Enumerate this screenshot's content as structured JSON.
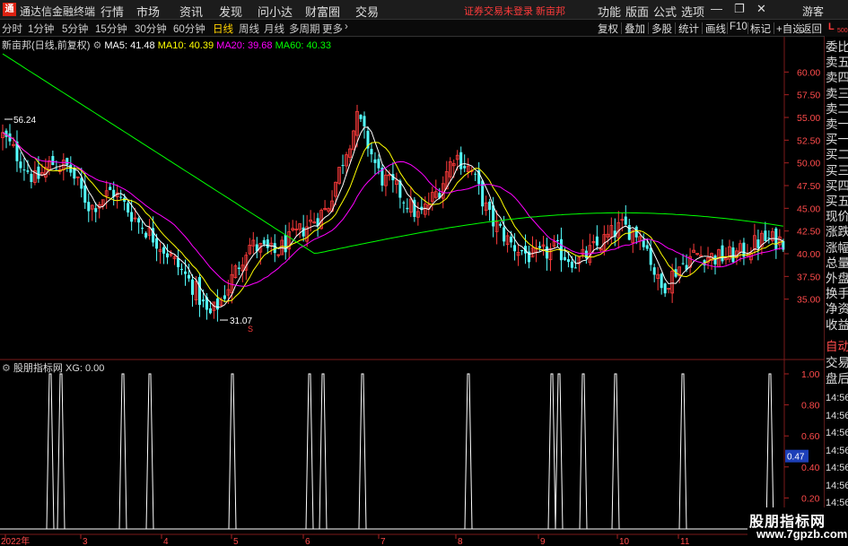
{
  "app": {
    "title": "通达信金融终端",
    "logo_glyph": "通"
  },
  "menu": [
    "行情",
    "市场",
    "资讯",
    "发现",
    "问小达",
    "财富圈",
    "交易"
  ],
  "warning": "证券交易未登录  新亩邦",
  "right_menu": [
    "功能",
    "版面",
    "公式",
    "选项"
  ],
  "guest_label": "游客",
  "periods": [
    "分时",
    "1分钟",
    "5分钟",
    "15分钟",
    "30分钟",
    "60分钟",
    "日线",
    "周线",
    "月线",
    "多周期",
    "更多"
  ],
  "active_period": "日线",
  "right_tools": [
    "复权",
    "叠加",
    "多股",
    "统计",
    "画线",
    "F10",
    "标记",
    "+自选",
    "返回"
  ],
  "l_badge": {
    "letter": "L",
    "num": "500"
  },
  "main_legend": {
    "name": "新亩邦(日线,前复权)",
    "ma5": "MA5: 41.48",
    "ma10": "MA10: 40.39",
    "ma20": "MA20: 39.68",
    "ma60": "MA60: 40.33"
  },
  "sub_legend": {
    "name": "股朋指标网",
    "xg": "XG: 0.00"
  },
  "quote_panel": [
    "委比",
    "卖五",
    "卖四",
    "卖三",
    "卖二",
    "卖一",
    "买一",
    "买二",
    "买三",
    "买四",
    "买五",
    "现价",
    "涨跌",
    "涨幅",
    "总量",
    "外盘",
    "换手",
    "净资",
    "收益"
  ],
  "lower_panel": [
    "自动",
    "交易",
    "盘后"
  ],
  "time_rows": [
    "14:56",
    "14:56",
    "14:56",
    "14:56",
    "14:56",
    "14:56",
    "14:56",
    "14:56",
    "14:56"
  ],
  "watermark": {
    "title": "股朋指标网",
    "url": "www.7gpzb.com"
  },
  "colors": {
    "up": "#ff3b3b",
    "down": "#54ffff",
    "ma5": "#ffffff",
    "ma10": "#ffff00",
    "ma20": "#ff00ff",
    "ma60": "#00ff00",
    "accent": "#ffd200"
  },
  "chart_data": [
    {
      "type": "candlestick",
      "title": "新亩邦(日线,前复权)",
      "y_ticks": [
        "60.00",
        "57.50",
        "55.00",
        "52.50",
        "50.00",
        "47.50",
        "45.00",
        "42.50",
        "40.00",
        "37.50",
        "35.00"
      ],
      "ylim": [
        32.5,
        62.5
      ],
      "x_labels": [
        "2022年",
        "3",
        "4",
        "5",
        "6",
        "7",
        "8",
        "9",
        "10",
        "11"
      ],
      "annotations": {
        "high": "56.24",
        "low": "31.07",
        "current_marker": "S"
      },
      "ma_values": {
        "MA5": 41.48,
        "MA10": 40.39,
        "MA20": 39.68,
        "MA60": 40.33
      }
    },
    {
      "type": "line",
      "title": "股朋指标网",
      "series_name": "XG",
      "current_value": 0.0,
      "y_ticks": [
        "1.00",
        "0.80",
        "0.60",
        "0.40",
        "0.20"
      ],
      "current_label": "0.47",
      "ylim": [
        0,
        1
      ],
      "signal_dates": [
        "2022年",
        "3",
        "3",
        "4",
        "4",
        "5",
        "6",
        "6",
        "6",
        "7",
        "8",
        "9",
        "9",
        "9",
        "10",
        "10",
        "11",
        "11"
      ],
      "signal_values": [
        1,
        1,
        1,
        1,
        1,
        1,
        1,
        1,
        1,
        1,
        1,
        1,
        1,
        1,
        1,
        1,
        1,
        1
      ]
    }
  ]
}
